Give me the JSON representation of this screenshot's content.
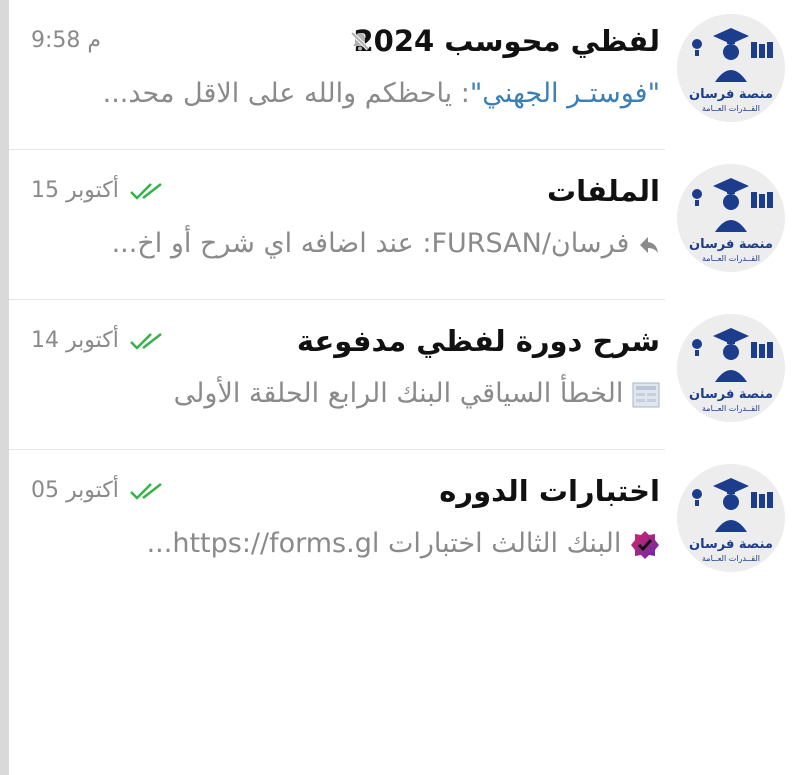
{
  "chats": [
    {
      "title": "لفظي محوسب 2024",
      "time": "9:58 م",
      "muted": true,
      "sender": "\"فوستـر الجهني\"",
      "preview": ": ياحظكم والله على الاقل محد...",
      "icon": "mute-icon"
    },
    {
      "title": "الملفات",
      "time": "15 أكتوبر",
      "status": "double-check-icon",
      "preview": "فرسان/FURSAN: عند اضافه اي شرح أو اخ...",
      "icon": "forward-icon"
    },
    {
      "title": "شرح دورة لفظي مدفوعة",
      "time": "14 أكتوبر",
      "status": "double-check-icon",
      "preview": "الخطأ السياقي البنك الرابع الحلقة الأولى",
      "icon": "video-thumbnail-icon"
    },
    {
      "title": "اختبارات الدوره",
      "time": "05 أكتوبر",
      "status": "double-check-icon",
      "preview": "البنك الثالث اختبارات  https://forms.gl...",
      "icon": "verified-badge-icon"
    }
  ],
  "avatar": {
    "line1": "منصة فرسان",
    "line2": "القــدرات العــامة"
  },
  "colors": {
    "check": "#35b34a",
    "sender": "#3a7fb5",
    "avatar_text": "#1c3d8c"
  }
}
